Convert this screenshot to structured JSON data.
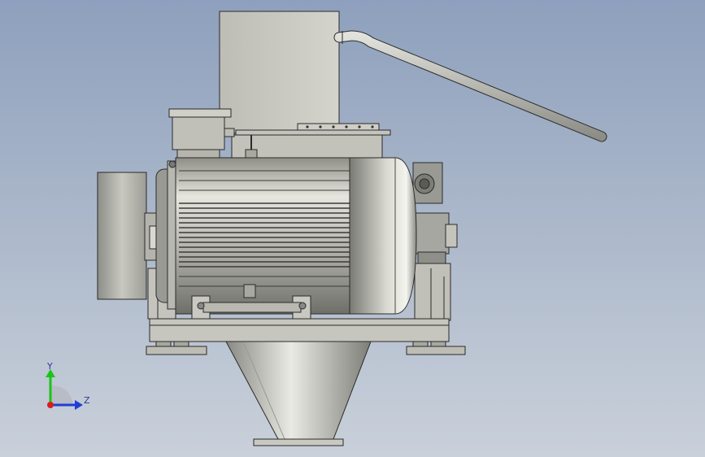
{
  "viewport": {
    "background_top": "#8ea0bd",
    "background_bottom": "#c9d0da"
  },
  "triad": {
    "y_label": "Y",
    "z_label": "Z",
    "y_color": "#19c419",
    "z_color": "#1e3fd6",
    "x_color": "#d61e1e"
  },
  "model": {
    "motor_color": "#c7c7c0",
    "edge_color": "#2a2a2a"
  }
}
